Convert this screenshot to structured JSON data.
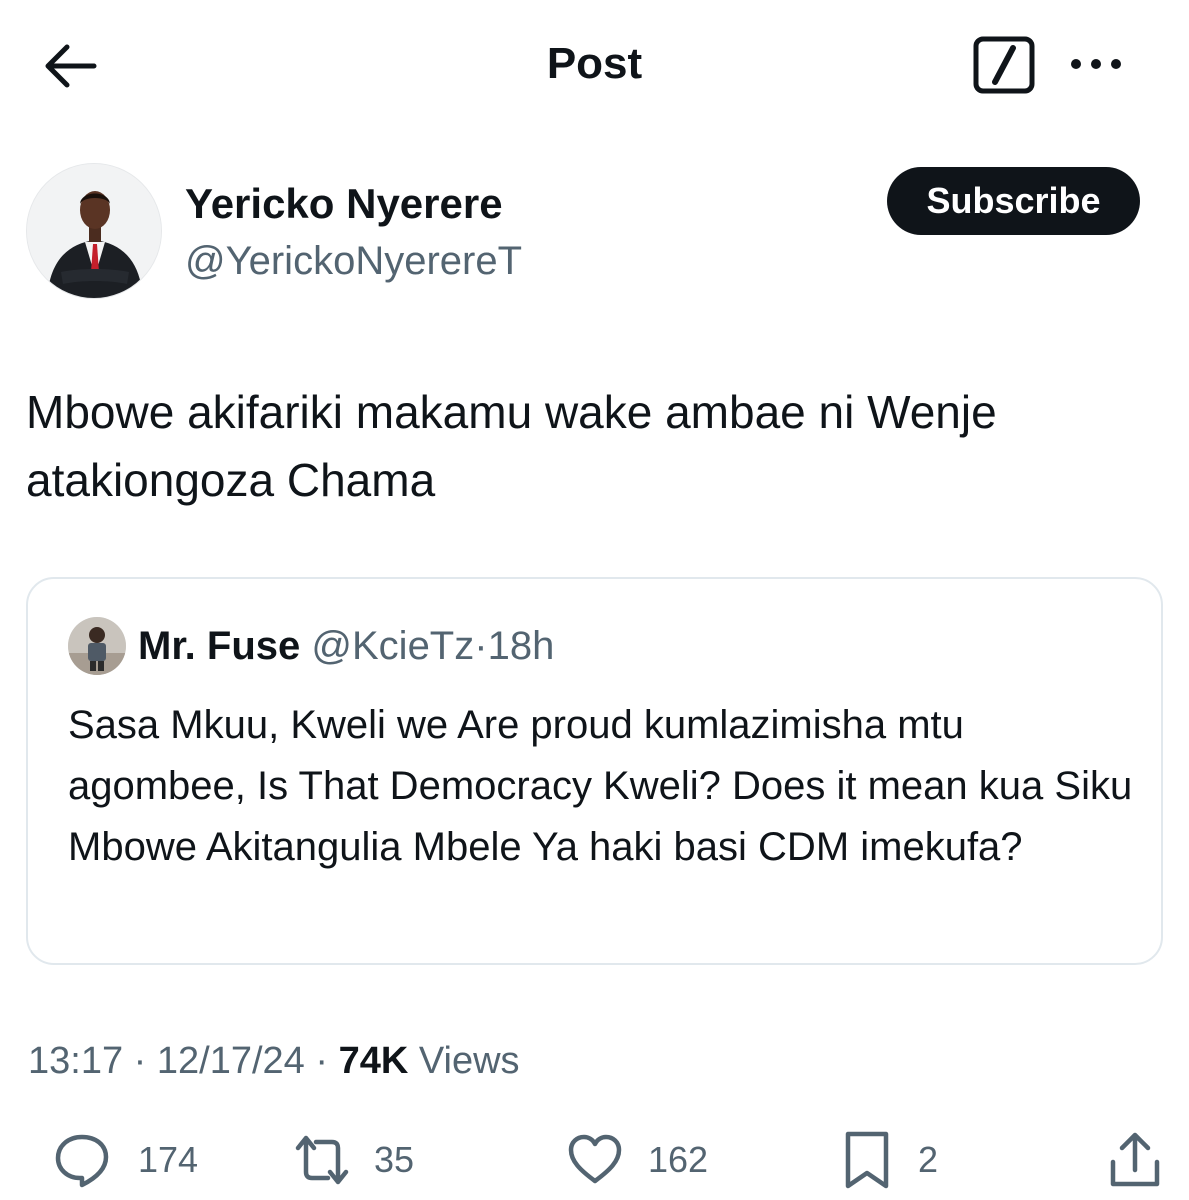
{
  "header": {
    "title": "Post",
    "back_icon": "arrow-left-icon",
    "grok_icon": "grok-icon",
    "more_icon": "more-horizontal-icon"
  },
  "author": {
    "name": "Yericko Nyerere",
    "handle": "@YerickoNyerereT",
    "subscribe_label": "Subscribe"
  },
  "tweet": {
    "text": "Mbowe akifariki makamu wake ambae ni Wenje atakiongoza Chama"
  },
  "quote": {
    "name": "Mr. Fuse",
    "handle": "@KcieTz",
    "separator": "·",
    "time": "18h",
    "text": "Sasa Mkuu, Kweli we Are proud kumlazimisha mtu agombee, Is That Democracy Kweli? Does it mean kua Siku Mbowe Akitangulia Mbele Ya haki basi CDM imekufa?"
  },
  "meta": {
    "time": "13:17",
    "sep1": "·",
    "date": "12/17/24",
    "sep2": "·",
    "views_count": "74K",
    "views_label": "Views"
  },
  "actions": {
    "replies": "174",
    "reposts": "35",
    "likes": "162",
    "bookmarks": "2"
  },
  "colors": {
    "text": "#0f1419",
    "secondary": "#536471",
    "border": "#e1e8ed",
    "button_bg": "#0f1419"
  }
}
